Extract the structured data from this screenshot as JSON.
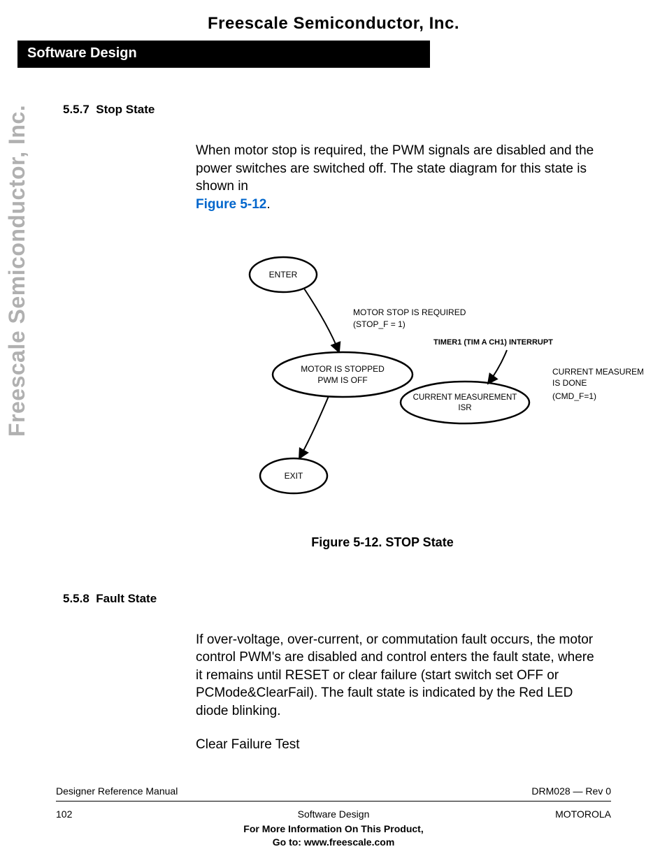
{
  "header": {
    "company": "Freescale Semiconductor, Inc.",
    "section_bar": "Software Design"
  },
  "sidebar_text": "Freescale Semiconductor, Inc.",
  "sections": {
    "s1": {
      "number": "5.5.7",
      "title": "Stop State",
      "body": "When motor stop is required, the PWM signals are disabled and the power switches are switched off. The state diagram for this state is shown in",
      "figure_link": "Figure 5-12",
      "period": "."
    },
    "s2": {
      "number": "5.5.8",
      "title": "Fault State",
      "body1": "If over-voltage, over-current, or commutation fault occurs, the motor control PWM's are disabled and control enters the fault state, where it remains until RESET or clear failure (start switch set OFF or PCMode&ClearFail). The fault state is indicated by the Red LED diode blinking.",
      "body2": "Clear Failure Test"
    }
  },
  "diagram": {
    "enter": "ENTER",
    "exit": "EXIT",
    "cond1a": "MOTOR STOP IS REQUIRED",
    "cond1b": "(STOP_F = 1)",
    "state1a": "MOTOR IS STOPPED",
    "state1b": "PWM IS OFF",
    "state2a": "CURRENT MEASUREMENT",
    "state2b": "ISR",
    "interrupt": "TIMER1 (TIM A CH1) INTERRUPT",
    "result1a": "CURRENT MEASUREMENT",
    "result1b": "IS DONE",
    "result1c": "(CMD_F=1)"
  },
  "figure_caption": "Figure 5-12. STOP State",
  "footer": {
    "left1": "Designer Reference Manual",
    "right1": "DRM028 — Rev 0",
    "left2": "102",
    "center2": "Software Design",
    "right2": "MOTOROLA",
    "more1": "For More Information On This Product,",
    "more2": "Go to: www.freescale.com"
  }
}
